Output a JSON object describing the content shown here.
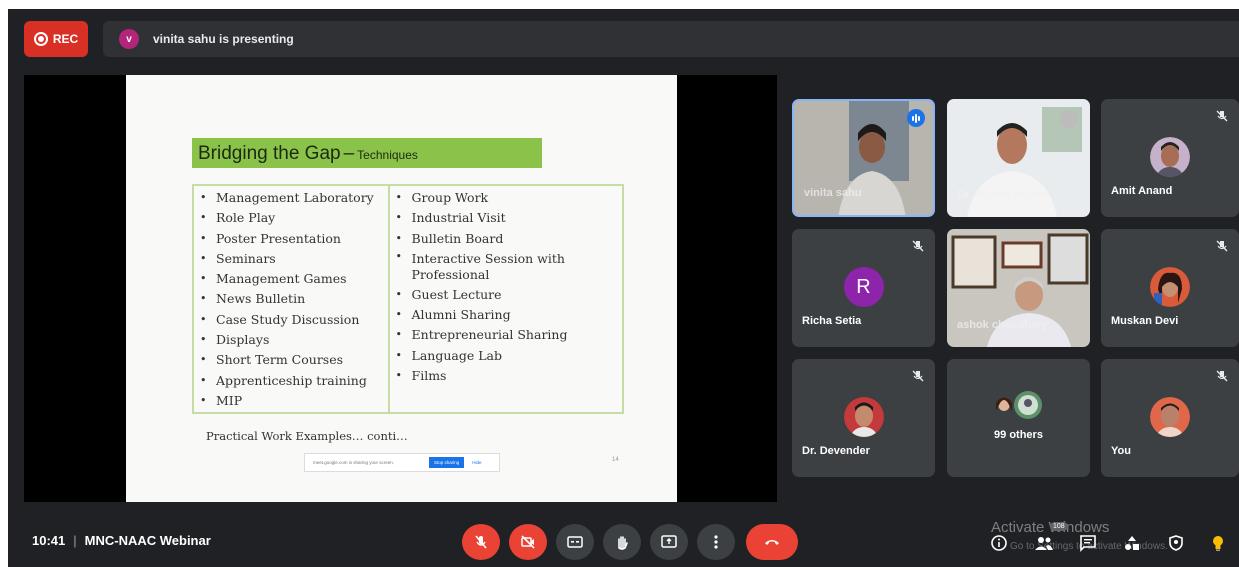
{
  "topbar": {
    "rec_label": "REC",
    "presenter_initial": "v",
    "presenting_text": "vinita sahu is presenting"
  },
  "slide": {
    "title_main": "Bridging the Gap",
    "title_dash": "–",
    "title_sub": "Techniques",
    "left_items": [
      "Management Laboratory",
      "Role Play",
      "Poster Presentation",
      "Seminars",
      "Management Games",
      "News Bulletin",
      "Case Study Discussion",
      "Displays",
      "Short Term Courses",
      "Apprenticeship training",
      "MIP"
    ],
    "right_items": [
      "Group Work",
      "Industrial Visit",
      "Bulletin Board",
      "Interactive Session with Professional",
      "Guest Lecture",
      "Alumni Sharing",
      "Entrepreneurial Sharing",
      "Language Lab",
      "Films"
    ],
    "footer_text": "Practical Work Examples… conti…",
    "share_bar_text": "meet.google.com is sharing your screen.",
    "stop_sharing_label": "Stop sharing",
    "hide_label": "Hide",
    "page_number": "14"
  },
  "participants": {
    "vinita": {
      "name": "vinita sahu"
    },
    "tile2": {
      "name": "Dr. Rajesh Kumar"
    },
    "amit": {
      "name": "Amit Anand"
    },
    "richa": {
      "name": "Richa Setia",
      "initial": "R"
    },
    "ashok": {
      "name": "ashok chaudhary"
    },
    "muskan": {
      "name": "Muskan Devi"
    },
    "devender": {
      "name": "Dr. Devender"
    },
    "others": {
      "label": "99 others"
    },
    "you": {
      "name": "You"
    }
  },
  "bottom": {
    "time": "10:41",
    "separator": "|",
    "meeting_title": "MNC-NAAC Webinar",
    "people_count": "108"
  },
  "watermark": {
    "line1": "Activate Windows",
    "line2": "Go to Settings to activate Windows."
  },
  "colors": {
    "background": "#202124",
    "tile": "#3c4043",
    "red": "#ea4335",
    "title_green": "#8bc34a",
    "accent_blue": "#1a73e8"
  }
}
